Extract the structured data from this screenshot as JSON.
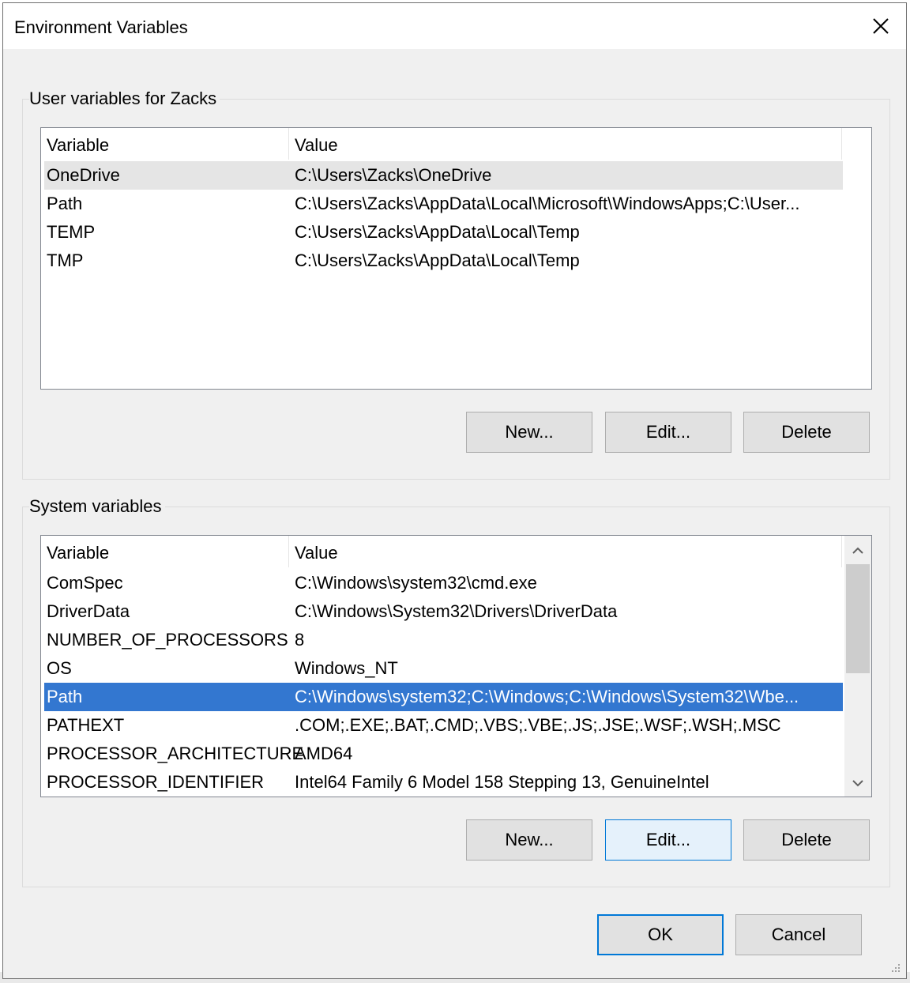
{
  "window": {
    "title": "Environment Variables"
  },
  "user_vars": {
    "label": "User variables for Zacks",
    "columns": [
      "Variable",
      "Value"
    ],
    "rows": [
      {
        "variable": "OneDrive",
        "value": "C:\\Users\\Zacks\\OneDrive"
      },
      {
        "variable": "Path",
        "value": "C:\\Users\\Zacks\\AppData\\Local\\Microsoft\\WindowsApps;C:\\User..."
      },
      {
        "variable": "TEMP",
        "value": "C:\\Users\\Zacks\\AppData\\Local\\Temp"
      },
      {
        "variable": "TMP",
        "value": "C:\\Users\\Zacks\\AppData\\Local\\Temp"
      }
    ],
    "buttons": {
      "new": "New...",
      "edit": "Edit...",
      "delete": "Delete"
    }
  },
  "system_vars": {
    "label": "System variables",
    "columns": [
      "Variable",
      "Value"
    ],
    "rows": [
      {
        "variable": "ComSpec",
        "value": "C:\\Windows\\system32\\cmd.exe"
      },
      {
        "variable": "DriverData",
        "value": "C:\\Windows\\System32\\Drivers\\DriverData"
      },
      {
        "variable": "NUMBER_OF_PROCESSORS",
        "value": "8"
      },
      {
        "variable": "OS",
        "value": "Windows_NT"
      },
      {
        "variable": "Path",
        "value": "C:\\Windows\\system32;C:\\Windows;C:\\Windows\\System32\\Wbe..."
      },
      {
        "variable": "PATHEXT",
        "value": ".COM;.EXE;.BAT;.CMD;.VBS;.VBE;.JS;.JSE;.WSF;.WSH;.MSC"
      },
      {
        "variable": "PROCESSOR_ARCHITECTURE",
        "value": "AMD64"
      },
      {
        "variable": "PROCESSOR_IDENTIFIER",
        "value": "Intel64 Family 6 Model 158 Stepping 13, GenuineIntel"
      }
    ],
    "selected_row": "Path",
    "buttons": {
      "new": "New...",
      "edit": "Edit...",
      "delete": "Delete"
    }
  },
  "footer": {
    "ok": "OK",
    "cancel": "Cancel"
  },
  "colors": {
    "selection": "#3377d0",
    "focus_border": "#0078d7",
    "dialog_bg": "#f0f0f0"
  },
  "icons": [
    "close-icon",
    "scroll-up-icon",
    "scroll-down-icon",
    "resize-grip-icon"
  ]
}
